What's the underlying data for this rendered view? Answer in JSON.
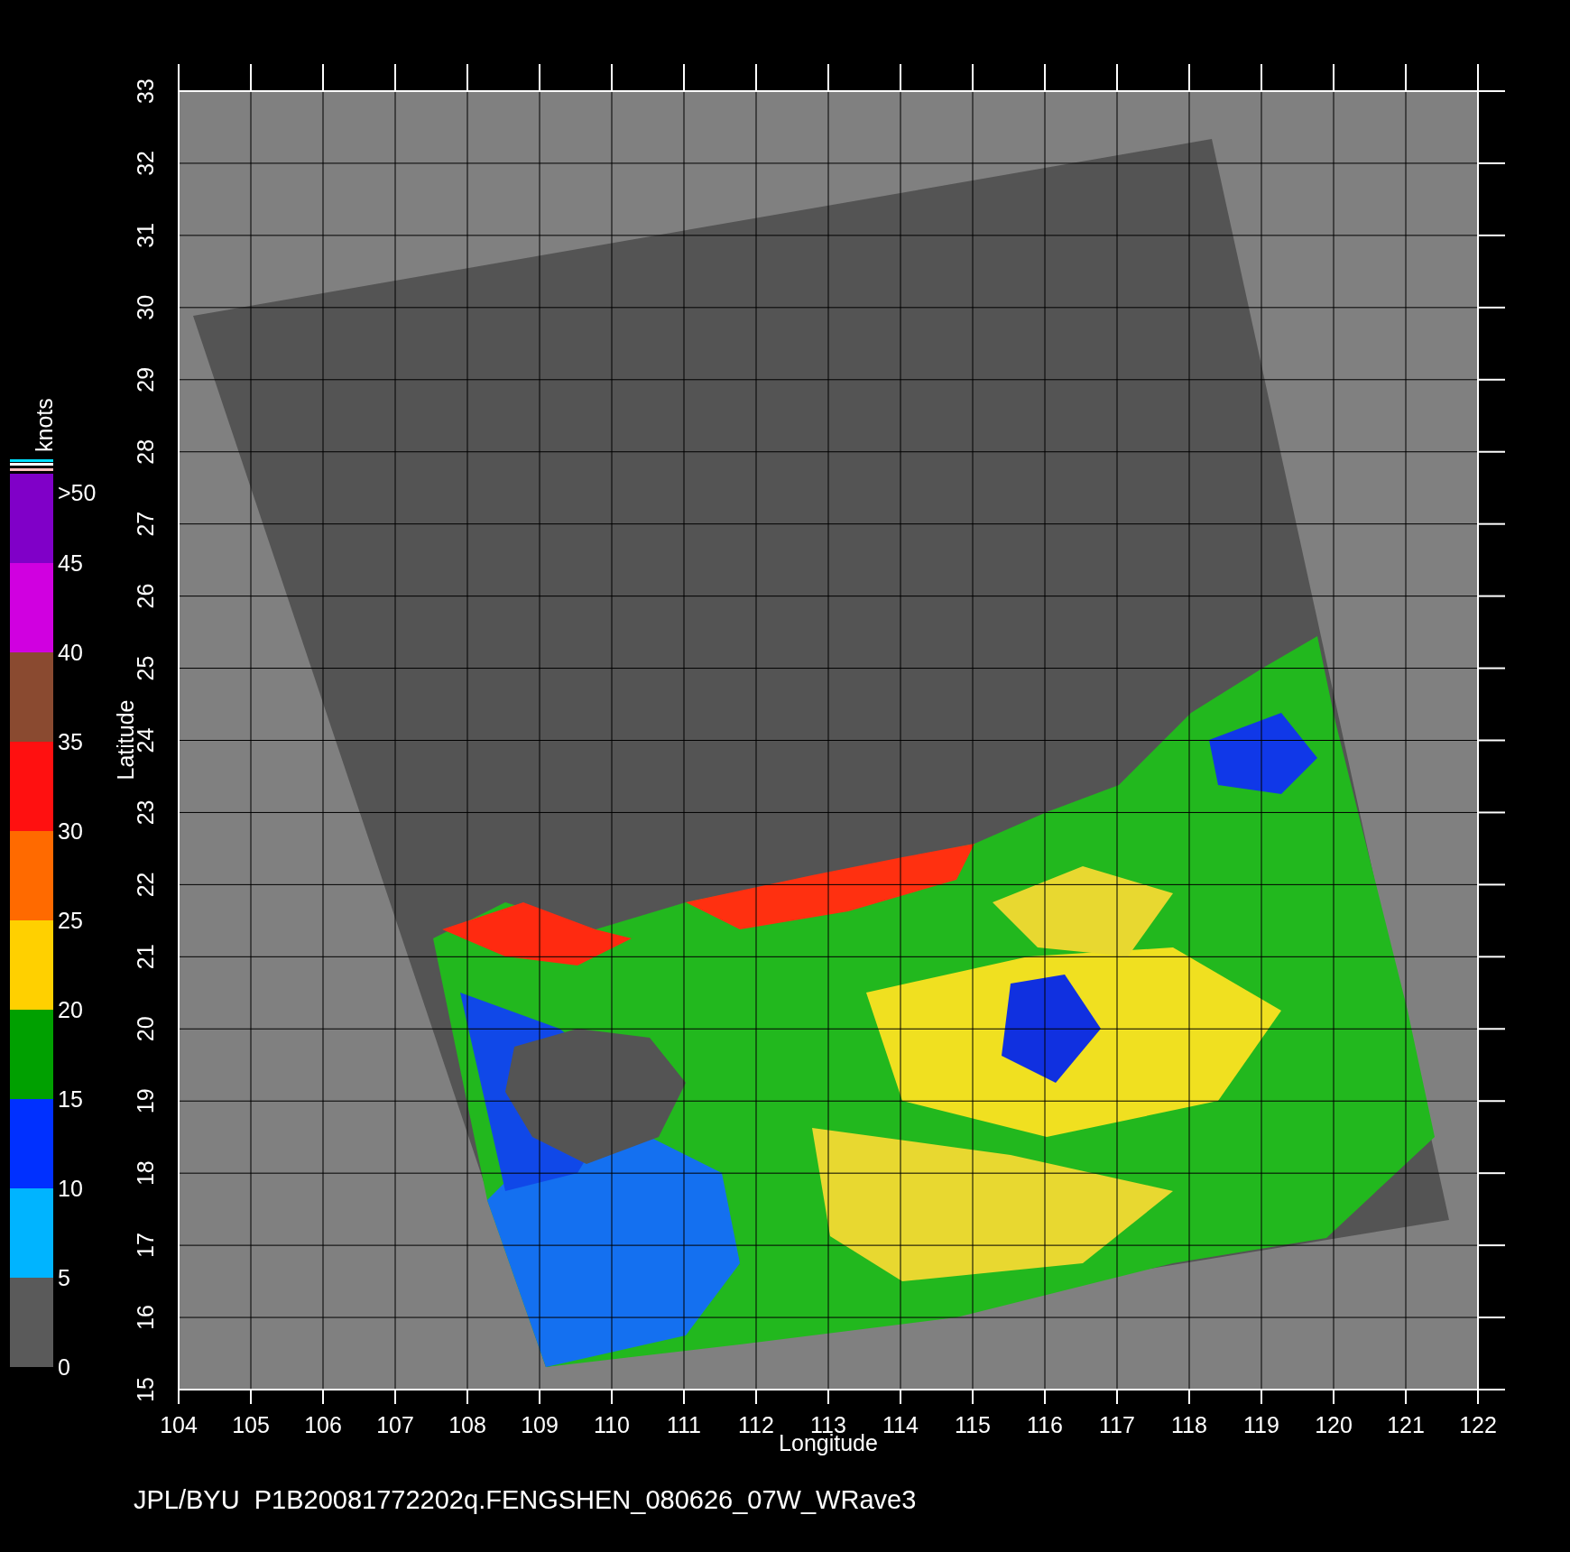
{
  "plot": {
    "x_axis": {
      "label": "Longitude",
      "ticks": [
        "104",
        "105",
        "106",
        "107",
        "108",
        "109",
        "110",
        "111",
        "112",
        "113",
        "114",
        "115",
        "116",
        "117",
        "118",
        "119",
        "120",
        "121",
        "122"
      ]
    },
    "y_axis": {
      "label": "Latitude",
      "ticks": [
        "15",
        "16",
        "17",
        "18",
        "19",
        "20",
        "21",
        "22",
        "23",
        "24",
        "25",
        "26",
        "27",
        "28",
        "29",
        "30",
        "31",
        "32",
        "33"
      ]
    }
  },
  "colorbar": {
    "unit": "knots",
    "labels": [
      ">50",
      "45",
      "40",
      "35",
      "30",
      "25",
      "20",
      "15",
      "10",
      "5",
      "0"
    ],
    "segments": [
      {
        "color": "#8000c8"
      },
      {
        "color": "#d000e0"
      },
      {
        "color": "#8a4a30"
      },
      {
        "color": "#ff1010"
      },
      {
        "color": "#ff6a00"
      },
      {
        "color": "#ffd000"
      },
      {
        "color": "#00a000"
      },
      {
        "color": "#0030ff"
      },
      {
        "color": "#00b4ff"
      },
      {
        "color": "#5a5a5a"
      }
    ]
  },
  "caption": "JPL/BYU  P1B20081772202q.FENGSHEN_080626_07W_WRave3"
}
